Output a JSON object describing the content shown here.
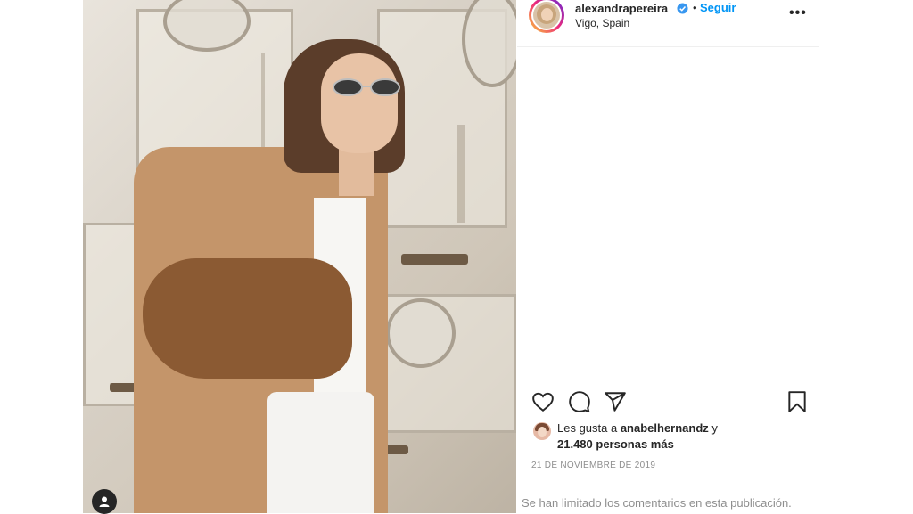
{
  "post": {
    "username": "alexandrapereira",
    "verified": true,
    "separator": "•",
    "follow_label": "Seguir",
    "location": "Vigo, Spain",
    "more_label": "•••",
    "likes": {
      "prefix": "Les gusta a ",
      "liker": "anabelhernandz",
      "connector": " y",
      "others": "21.480 personas más"
    },
    "date": "21 DE NOVIEMBRE DE 2019",
    "comments_notice": "Se han limitado los comentarios en esta publicación."
  },
  "icons": {
    "like": "heart-icon",
    "comment": "comment-icon",
    "share": "paper-plane-icon",
    "save": "bookmark-icon",
    "verified": "verified-badge-icon",
    "user": "user-icon",
    "more": "more-options-icon"
  },
  "colors": {
    "accent": "#0095f6",
    "text": "#262626",
    "muted": "#8e8e8e",
    "divider": "#efefef"
  }
}
